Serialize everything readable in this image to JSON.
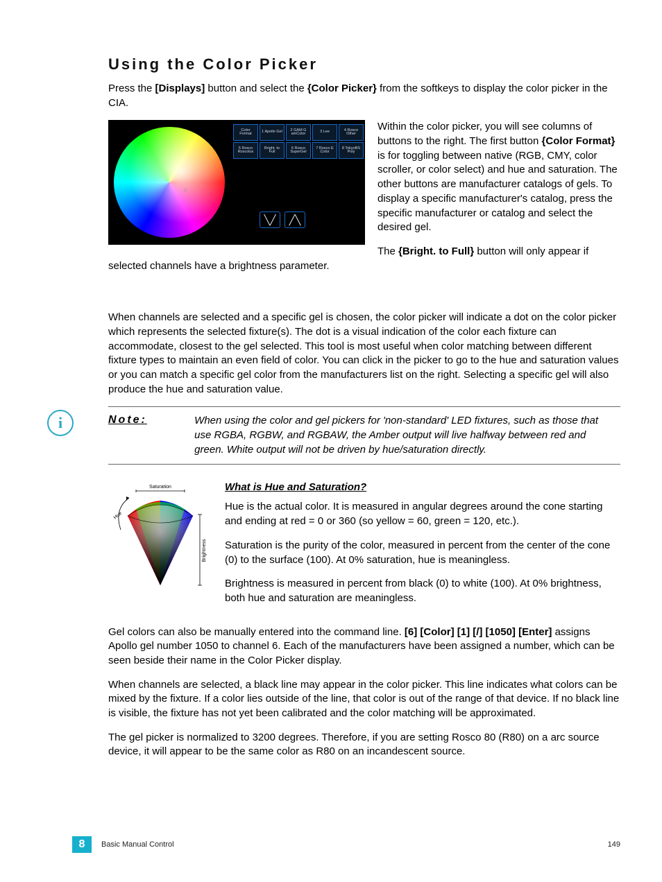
{
  "title": "Using the Color Picker",
  "intro": {
    "p1_pre": "Press the ",
    "p1_btn": "[Displays]",
    "p1_mid": " button and select the ",
    "p1_soft": "{Color Picker}",
    "p1_post": " from the softkeys to display the color picker in the CIA."
  },
  "picker_buttons": [
    "Color Format",
    "1 Apollo Gel",
    "2 GAM G amColor",
    "3 Lee",
    "4 Rosco Other",
    "5 Rosco Roscolux",
    "Bright. to Full",
    "6 Rosco SuperGel",
    "7 Rosco E Color",
    "8 TokyoBS Poly"
  ],
  "right_p1_a": "Within the color picker, you will see columns of buttons to the right. The first button ",
  "right_p1_b": "{Color Format}",
  "right_p1_c": " is for toggling between native (RGB, CMY, color scroller, or color select) and hue and saturation. The other buttons are manufacturer catalogs of gels. To display a specific manufacturer's catalog, press the specific manufacturer or catalog and select the desired gel.",
  "right_p2_a": "The ",
  "right_p2_b": "{Bright. to Full}",
  "right_p2_c": " button will only appear if selected channels have a brightness parameter.",
  "mid_p": "When channels are selected and a specific gel is chosen, the color picker will indicate a dot on the color picker which represents the selected fixture(s). The dot is a visual indication of the color each fixture can accommodate, closest to the gel selected. This tool is most useful when color matching between different fixture types to maintain an even field of color. You can click in the picker to go to the hue and saturation values or you can match a specific gel color from the manufacturers list on the right. Selecting a specific gel will also produce the hue and saturation value.",
  "note_label": "Note:",
  "note_body": "When using the color and gel pickers for 'non-standard' LED fixtures, such as those that use RGBA, RGBW, and RGBAW, the Amber output will live halfway between red and green. White output will not be driven by hue/saturation directly.",
  "hs_heading": "What is Hue and Saturation?",
  "hs_p1": "Hue is the actual color. It is measured in angular degrees around the cone starting and ending at red = 0 or 360 (so yellow = 60, green = 120, etc.).",
  "hs_p2": "Saturation is the purity of the color, measured in percent from the center of the cone (0) to the surface (100). At 0% saturation, hue is meaningless.",
  "hs_p3": "Brightness is measured in percent from black (0) to white (100). At 0% brightness, both hue and saturation are meaningless.",
  "cone_labels": {
    "sat": "Saturation",
    "hue": "Hue",
    "bright": "Brightness"
  },
  "after_p1_a": "Gel colors can also be manually entered into the command line. ",
  "after_p1_b": "[6] [Color] [1] [/] [1050] [Enter]",
  "after_p1_c": " assigns Apollo gel number 1050 to channel 6. Each of the manufacturers have been assigned a number, which can be seen beside their name in the Color Picker display.",
  "after_p2": "When channels are selected, a black line may appear in the color picker. This line indicates what colors can be mixed by the fixture. If a color lies outside of the line, that color is out of the range of that device. If no black line is visible, the fixture has not yet been calibrated and the color matching will be approximated.",
  "after_p3": "The gel picker is normalized to 3200 degrees. Therefore, if you are setting Rosco 80 (R80) on a arc source device, it will appear to be the same color as R80 on an incandescent source.",
  "footer": {
    "chapter": "8",
    "section": "Basic Manual Control",
    "page": "149"
  }
}
